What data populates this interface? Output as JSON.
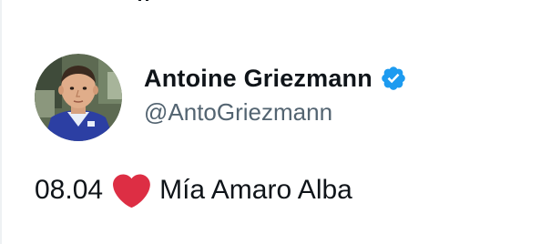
{
  "tweet": {
    "author": {
      "display_name": "Antoine Griezmann",
      "handle": "@AntoGriezmann",
      "verified": true,
      "avatar_icon": "child-portrait-avatar"
    },
    "text_date": "08.04",
    "text_emoji": "red-heart-icon",
    "text_name": "Mía Amaro Alba"
  },
  "colors": {
    "verified_blue": "#1d9bf0",
    "heart_red": "#dd2e44",
    "handle_gray": "#536471"
  }
}
